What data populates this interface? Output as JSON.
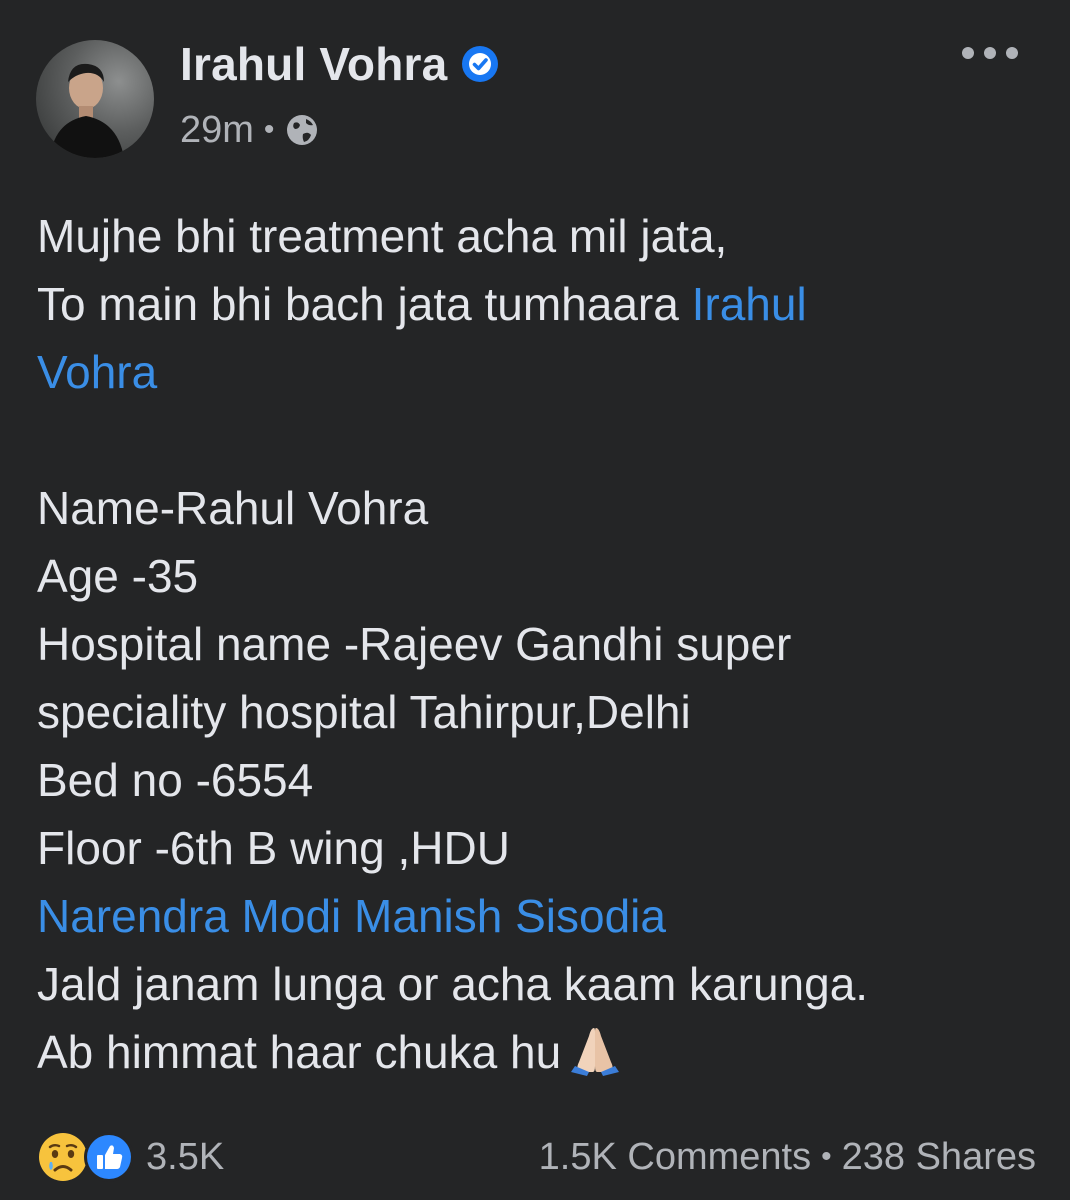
{
  "author": {
    "name": "Irahul Vohra",
    "verified": true,
    "time": "29m",
    "privacy_icon": "globe-icon"
  },
  "post": {
    "lines": [
      "Mujhe bhi treatment acha mil jata,",
      "To main bhi bach jata tumhaara ",
      "Irahul",
      "Vohra",
      "Name-Rahul Vohra",
      "Age -35",
      "Hospital name -Rajeev Gandhi super",
      "speciality hospital Tahirpur,Delhi",
      "Bed no -6554",
      "Floor -6th B wing ,HDU",
      "Narendra Modi Manish Sisodia",
      "Jald janam lunga or acha kaam karunga.",
      "Ab himmat haar chuka hu"
    ],
    "trailing_emoji": "folded-hands-icon"
  },
  "footer": {
    "reaction_icons": [
      "sad-reaction-icon",
      "like-reaction-icon"
    ],
    "reaction_count": "3.5K",
    "comments": "1.5K Comments",
    "separator": "•",
    "shares": "238 Shares"
  },
  "colors": {
    "background": "#242526",
    "text": "#e4e6eb",
    "secondary_text": "#b0b3b8",
    "link": "#3a8ee6",
    "verified_badge": "#1877f2"
  }
}
